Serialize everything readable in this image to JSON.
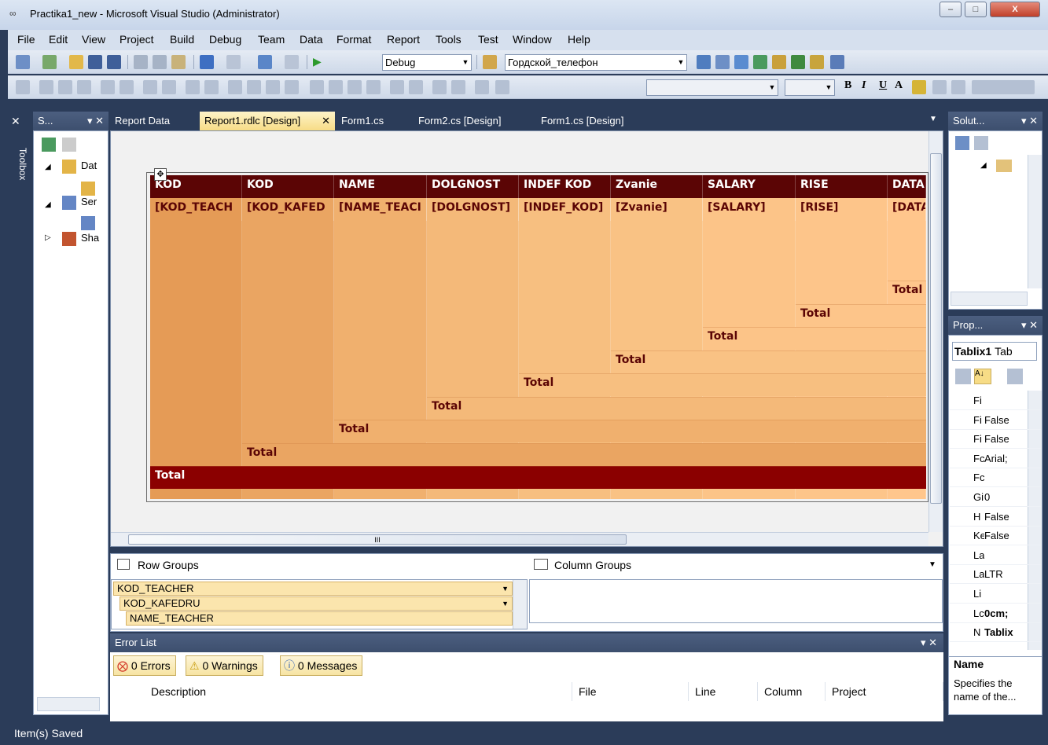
{
  "window": {
    "title": "Practika1_new - Microsoft Visual Studio (Administrator)",
    "min": "–",
    "max": "□",
    "close": "X"
  },
  "menu": [
    "File",
    "Edit",
    "View",
    "Project",
    "Build",
    "Debug",
    "Team",
    "Data",
    "Format",
    "Report",
    "Tools",
    "Test",
    "Window",
    "Help"
  ],
  "toolbar": {
    "config": "Debug",
    "target": "Гордской_телефон",
    "bold": "B",
    "italic": "I",
    "underline": "U",
    "font_a": "A"
  },
  "left_panel": {
    "toolbox_tab": "Toolbox",
    "server_explorer_title": "S...",
    "tree": [
      "Dat",
      "Ser",
      "Sha"
    ]
  },
  "tabs": [
    {
      "label": "Report Data",
      "active": false
    },
    {
      "label": "Report1.rdlc [Design]",
      "active": true
    },
    {
      "label": "Form1.cs",
      "active": false
    },
    {
      "label": "Form2.cs [Design]",
      "active": false
    },
    {
      "label": "Form1.cs [Design]",
      "active": false
    }
  ],
  "tablix": {
    "headers": [
      "KOD",
      "KOD",
      "NAME",
      "DOLGNOST",
      "INDEF KOD",
      "Zvanie",
      "SALARY",
      "RISE",
      "DATA"
    ],
    "detail": [
      "[KOD_TEACH",
      "[KOD_KAFED",
      "[NAME_TEACI",
      "[DOLGNOST]",
      "[INDEF_KOD]",
      "[Zvanie]",
      "[SALARY]",
      "[RISE]",
      "[DATA"
    ],
    "total_label": "Total",
    "scroll_marker": "III"
  },
  "groups": {
    "row_title": "Row Groups",
    "column_title": "Column Groups",
    "row_items": [
      "KOD_TEACHER",
      "KOD_KAFEDRU",
      "NAME_TEACHER"
    ]
  },
  "error_list": {
    "title": "Error List",
    "errors": "0 Errors",
    "warnings": "0 Warnings",
    "messages": "0 Messages",
    "columns": [
      "Description",
      "File",
      "Line",
      "Column",
      "Project"
    ]
  },
  "solution_panel": {
    "title": "Solut..."
  },
  "properties": {
    "title": "Prop...",
    "object": "Tablix1",
    "object_type": "Tab",
    "rows": [
      {
        "n": "Fi",
        "v": ""
      },
      {
        "n": "Fi",
        "v": "False"
      },
      {
        "n": "Fi",
        "v": "False"
      },
      {
        "n": "Fc",
        "v": "Arial;"
      },
      {
        "n": "Fc",
        "v": ""
      },
      {
        "n": "Gi",
        "v": "0"
      },
      {
        "n": "H",
        "v": "False"
      },
      {
        "n": "Ke",
        "v": "False"
      },
      {
        "n": "La",
        "v": ""
      },
      {
        "n": "La",
        "v": "LTR"
      },
      {
        "n": "Li",
        "v": ""
      },
      {
        "n": "Lc",
        "v": "0cm;"
      },
      {
        "n": "N",
        "v": "Tablix"
      }
    ],
    "desc_title": "Name",
    "desc_text": "Specifies the name of the..."
  },
  "status": "Item(s) Saved",
  "colors": {
    "header_bg": "#5b0505",
    "detail_bg": "#ffc68c",
    "total_dark": "#8b0000",
    "ide_dark": "#2b3c59"
  }
}
